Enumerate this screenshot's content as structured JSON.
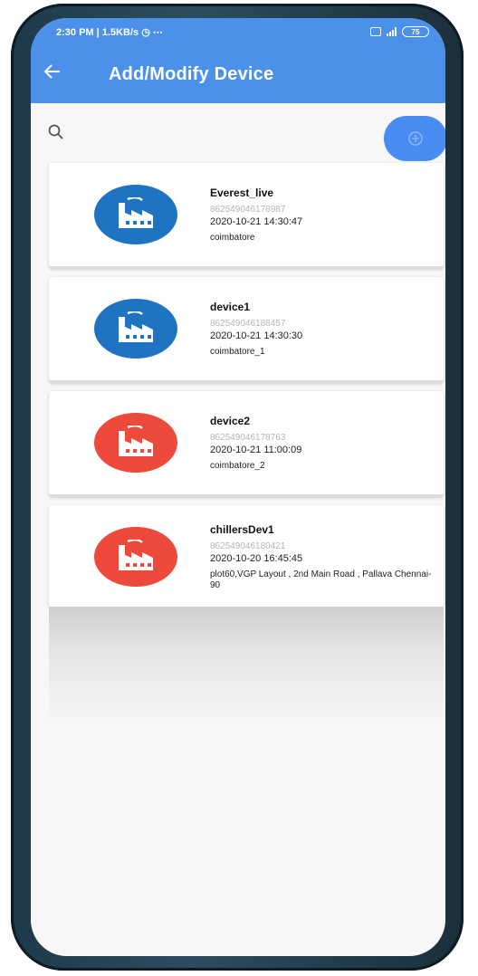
{
  "status_bar": {
    "time_speed": "2:30 PM | 1.5KB/s",
    "extra": "⋯",
    "battery": "75"
  },
  "app_bar": {
    "title": "Add/Modify Device"
  },
  "icons": {
    "back": "arrow-left-icon",
    "search": "search-icon",
    "add": "add-circle-icon",
    "device": "factory-icon"
  },
  "colors": {
    "primary": "#4b90e9",
    "fab": "#4a8df2",
    "active_device": "#1e73c3",
    "inactive_device": "#ec4a3a"
  },
  "devices": [
    {
      "name": "Everest_live",
      "id": "862549046178987",
      "date": "2020-10-21 14:30:47",
      "location": "coimbatore",
      "status_color": "#1e73c3"
    },
    {
      "name": "device1",
      "id": "862549046188457",
      "date": "2020-10-21 14:30:30",
      "location": "coimbatore_1",
      "status_color": "#1e73c3"
    },
    {
      "name": "device2",
      "id": "862549046178763",
      "date": "2020-10-21 11:00:09",
      "location": "coimbatore_2",
      "status_color": "#ec4a3a"
    },
    {
      "name": "chillersDev1",
      "id": "862549046180421",
      "date": "2020-10-20 16:45:45",
      "location": "plot60,VGP Layout , 2nd Main Road , Pallava Chennai-90",
      "status_color": "#ec4a3a"
    }
  ]
}
